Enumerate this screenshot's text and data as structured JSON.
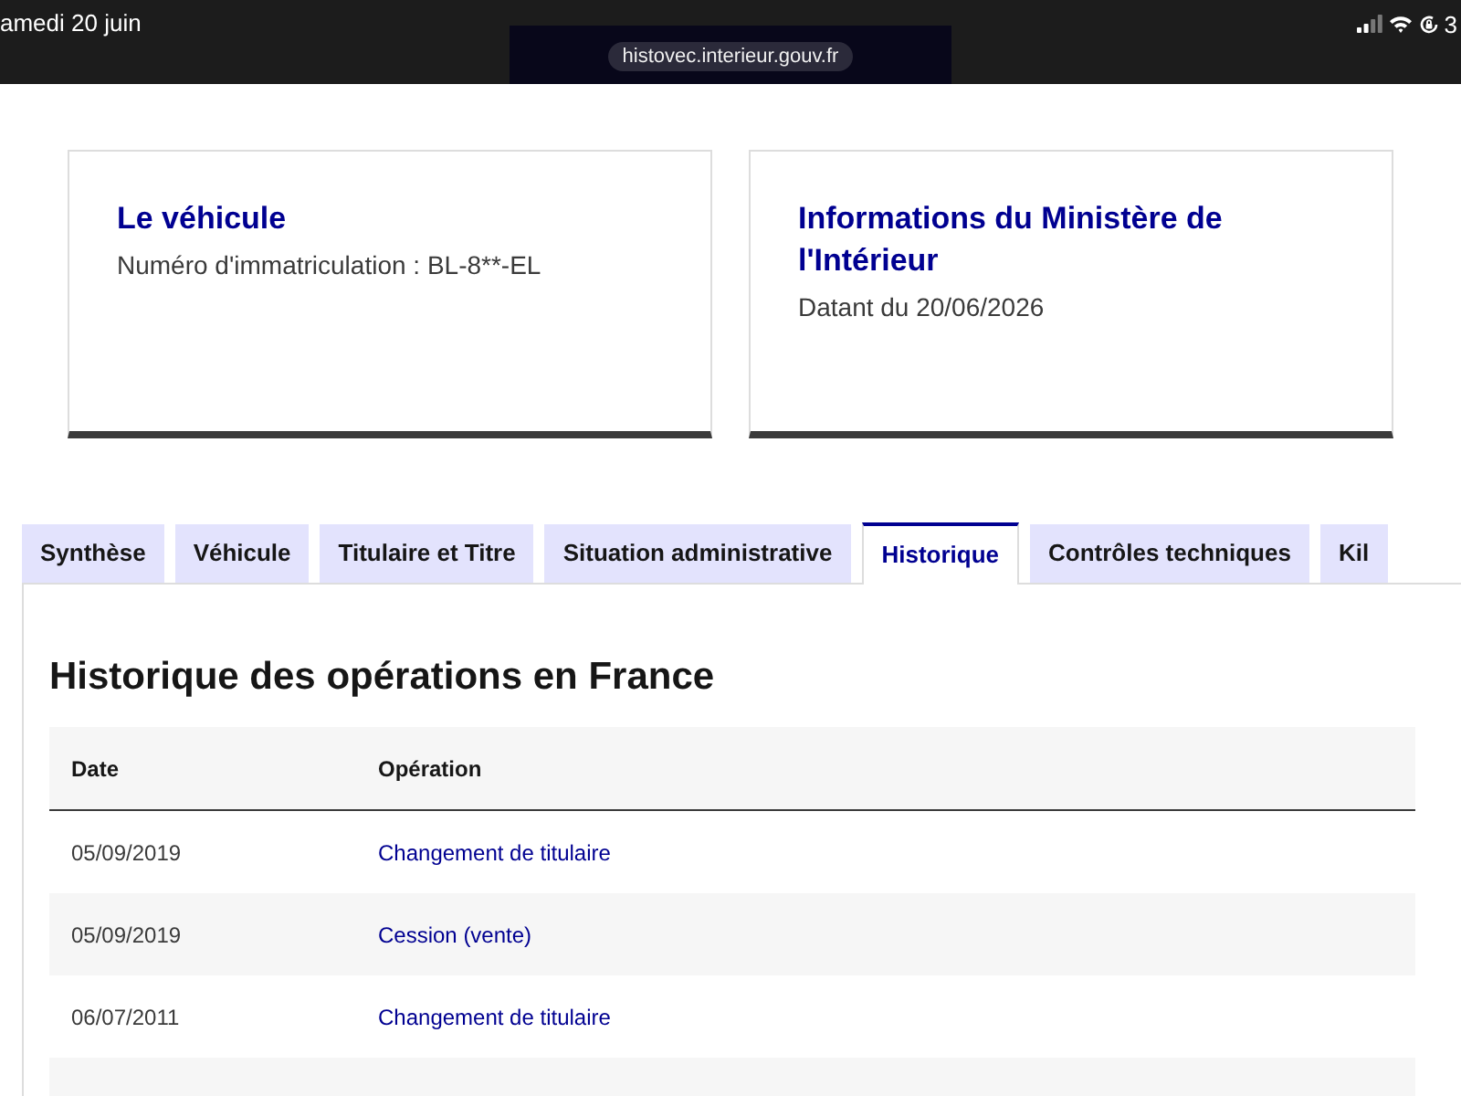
{
  "status_bar": {
    "date": "amedi 20 juin",
    "url": "histovec.interieur.gouv.fr",
    "time": "3"
  },
  "cards": [
    {
      "title": "Le véhicule",
      "text": "Numéro d'immatriculation : BL-8**-EL"
    },
    {
      "title": "Informations du Ministère de l'Intérieur",
      "text": "Datant du 20/06/2026"
    }
  ],
  "tabs": [
    {
      "label": "Synthèse",
      "selected": false
    },
    {
      "label": "Véhicule",
      "selected": false
    },
    {
      "label": "Titulaire et Titre",
      "selected": false
    },
    {
      "label": "Situation administrative",
      "selected": false
    },
    {
      "label": "Historique",
      "selected": true
    },
    {
      "label": "Contrôles techniques",
      "selected": false
    },
    {
      "label": "Kil",
      "selected": false
    }
  ],
  "section": {
    "title": "Historique des opérations en France",
    "table": {
      "columns": [
        "Date",
        "Opération"
      ],
      "rows": [
        {
          "date": "05/09/2019",
          "operation": "Changement de titulaire"
        },
        {
          "date": "05/09/2019",
          "operation": "Cession (vente)"
        },
        {
          "date": "06/07/2011",
          "operation": "Changement de titulaire"
        }
      ]
    }
  }
}
